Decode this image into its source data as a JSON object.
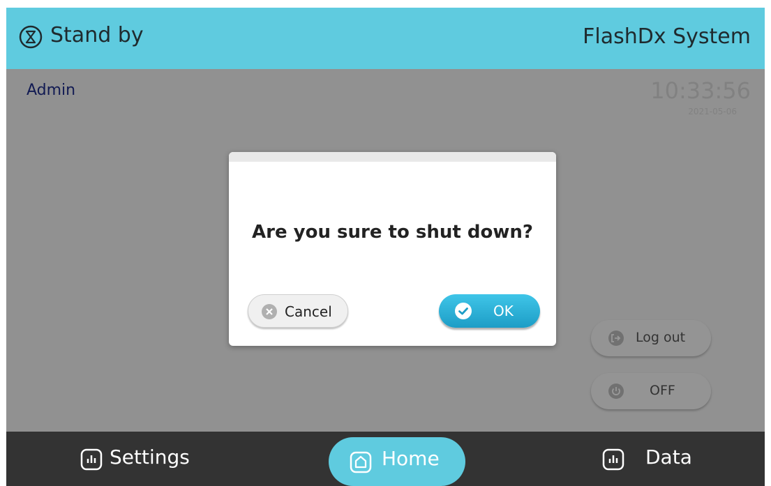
{
  "header": {
    "status_icon": "hourglass-icon",
    "status_text": "Stand by",
    "system_name": "FlashDx System"
  },
  "main": {
    "user": "Admin",
    "clock_time": "10:33:56",
    "clock_date": "2021-05-06",
    "logout_label": "Log out",
    "logout_icon": "logout-icon",
    "off_label": "OFF",
    "off_icon": "power-icon"
  },
  "dialog": {
    "message": "Are you sure to shut down?",
    "cancel_label": "Cancel",
    "cancel_icon": "close-circle-icon",
    "ok_label": "OK",
    "ok_icon": "check-circle-icon"
  },
  "nav": {
    "settings_label": "Settings",
    "settings_icon": "bar-chart-icon",
    "home_label": "Home",
    "home_icon": "home-icon",
    "data_label": "Data",
    "data_icon": "bar-chart-icon"
  },
  "colors": {
    "accent": "#5fcbdf",
    "nav_bg": "#333333",
    "ok_button": "#1d9dc6",
    "user_text": "#1f2d8a"
  }
}
